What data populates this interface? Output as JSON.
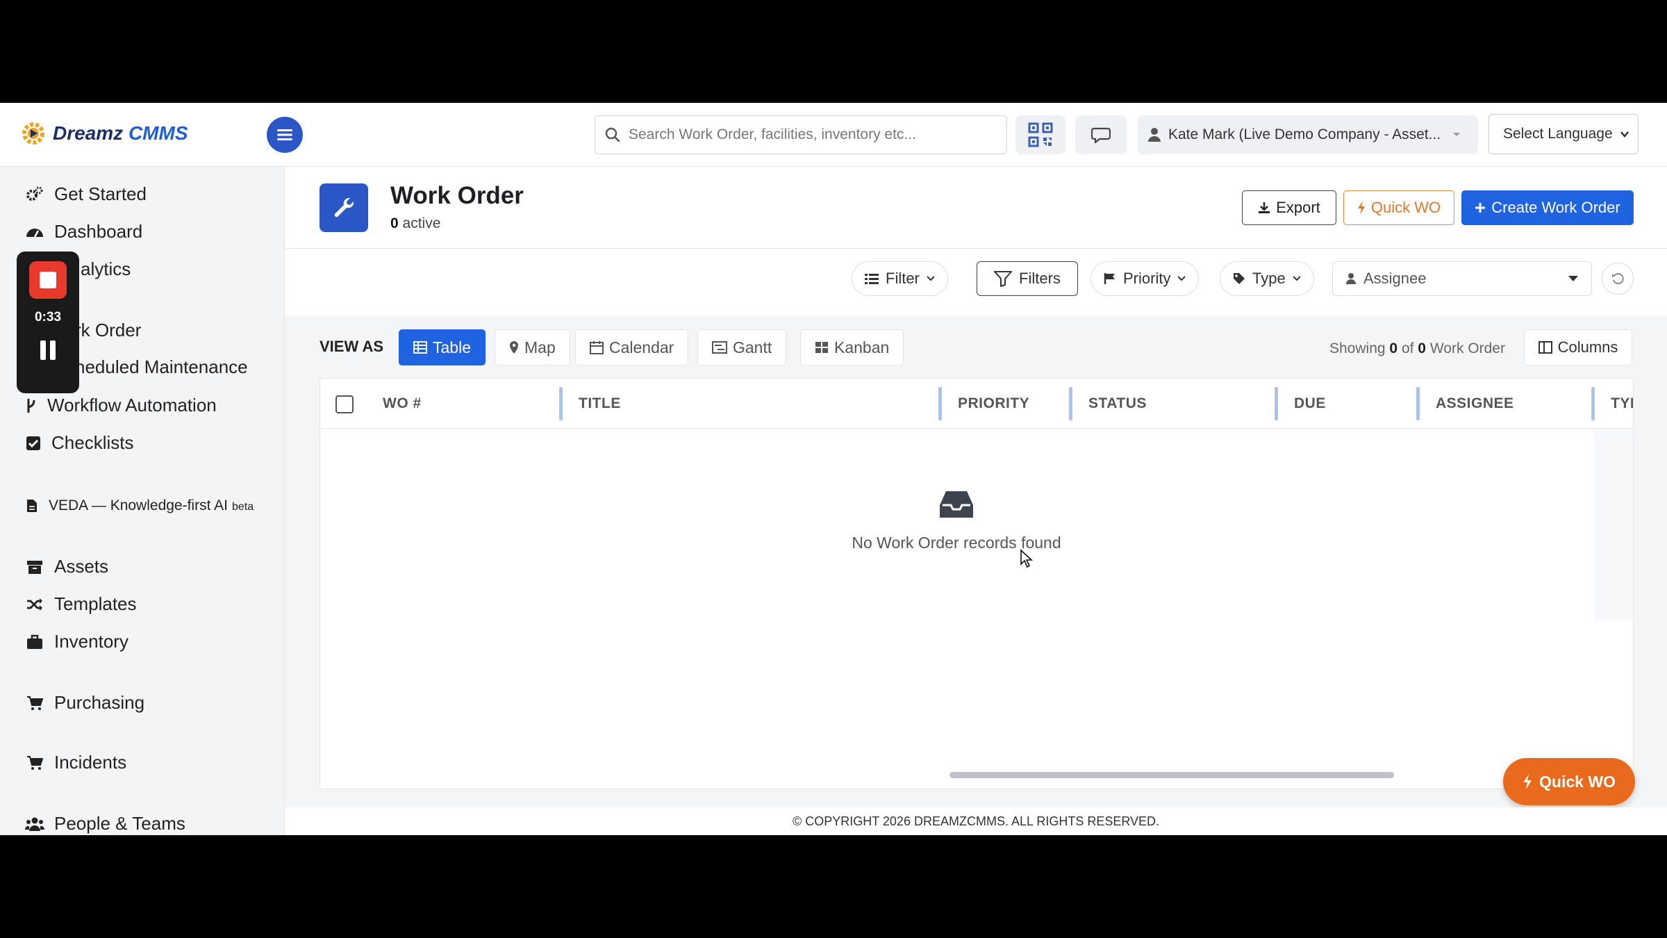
{
  "app": {
    "logo_main": "Dreamz",
    "logo_accent": "CMMS"
  },
  "topbar": {
    "search_placeholder": "Search Work Order, facilities, inventory etc...",
    "user_label": "Kate Mark (Live Demo Company - Asset...",
    "language_label": "Select Language"
  },
  "sidebar": {
    "items": [
      {
        "label": "Get Started",
        "icon": "gears-icon"
      },
      {
        "label": "Dashboard",
        "icon": "dashboard-icon"
      },
      {
        "label": "alytics",
        "icon": "analytics-icon"
      },
      {
        "label": "rk Order",
        "icon": "work-order-icon"
      },
      {
        "label": "heduled Maintenance",
        "icon": "calendar-icon"
      },
      {
        "label": "Workflow Automation",
        "icon": "branch-icon"
      },
      {
        "label": "Checklists",
        "icon": "check-square-icon"
      },
      {
        "label": "VEDA — Knowledge-first AI",
        "badge": "beta",
        "icon": "file-icon"
      },
      {
        "label": "Assets",
        "icon": "archive-icon"
      },
      {
        "label": "Templates",
        "icon": "shuffle-icon"
      },
      {
        "label": "Inventory",
        "icon": "briefcase-icon"
      },
      {
        "label": "Purchasing",
        "icon": "cart-icon"
      },
      {
        "label": "Incidents",
        "icon": "cart-icon"
      },
      {
        "label": "People & Teams",
        "icon": "users-icon"
      }
    ]
  },
  "recorder": {
    "time": "0:33"
  },
  "page": {
    "title": "Work Order",
    "active_count": "0",
    "active_label": "active",
    "export_label": "Export",
    "quick_wo_label": "Quick WO",
    "create_label": "Create Work Order"
  },
  "filters": {
    "filter_label": "Filter",
    "filters_label": "Filters",
    "priority_label": "Priority",
    "type_label": "Type",
    "assignee_label": "Assignee"
  },
  "views": {
    "view_as_label": "VIEW AS",
    "options": [
      "Table",
      "Map",
      "Calendar",
      "Gantt",
      "Kanban"
    ],
    "active": "Table",
    "showing_prefix": "Showing",
    "showing_from": "0",
    "showing_of": "of",
    "showing_total": "0",
    "showing_suffix": "Work Order",
    "columns_label": "Columns"
  },
  "table": {
    "columns": [
      "WO #",
      "TITLE",
      "PRIORITY",
      "STATUS",
      "DUE",
      "ASSIGNEE",
      "TYI"
    ],
    "empty_message": "No Work Order records found"
  },
  "fab": {
    "label": "Quick WO"
  },
  "footer": {
    "copyright": "© COPYRIGHT 2026 DREAMZCMMS. ALL RIGHTS RESERVED."
  },
  "colors": {
    "primary": "#1f63e0",
    "accent_orange": "#ea6a1d",
    "recorder_red": "#e8392c"
  }
}
